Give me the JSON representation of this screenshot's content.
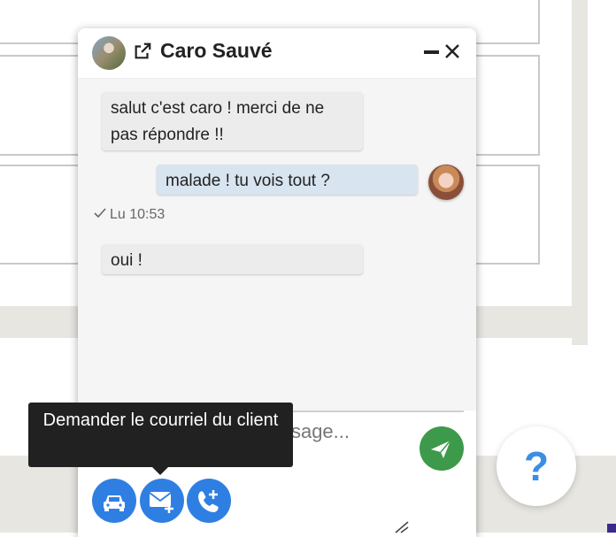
{
  "chat": {
    "contact_name": "Caro Sauvé",
    "messages": [
      {
        "direction": "incoming",
        "text": "salut c'est caro ! merci de ne pas répondre !!"
      },
      {
        "direction": "outgoing",
        "text": "malade ! tu vois tout ?"
      },
      {
        "direction": "incoming",
        "text": "oui !"
      }
    ],
    "read_receipt": "Lu 10:53",
    "compose": {
      "placeholder": "Envoyer un message..."
    },
    "actions": {
      "car_icon": "car-icon",
      "mail_icon": "mail-plus-icon",
      "phone_icon": "phone-plus-icon"
    },
    "tooltip": "Demander le courriel du client"
  },
  "help": {
    "label": "?"
  },
  "colors": {
    "action_blue": "#2f7fe3",
    "send_green": "#3d9a4b",
    "outgoing_bubble": "#d8e4ef",
    "incoming_bubble": "#ececec",
    "tooltip_bg": "#212121"
  }
}
